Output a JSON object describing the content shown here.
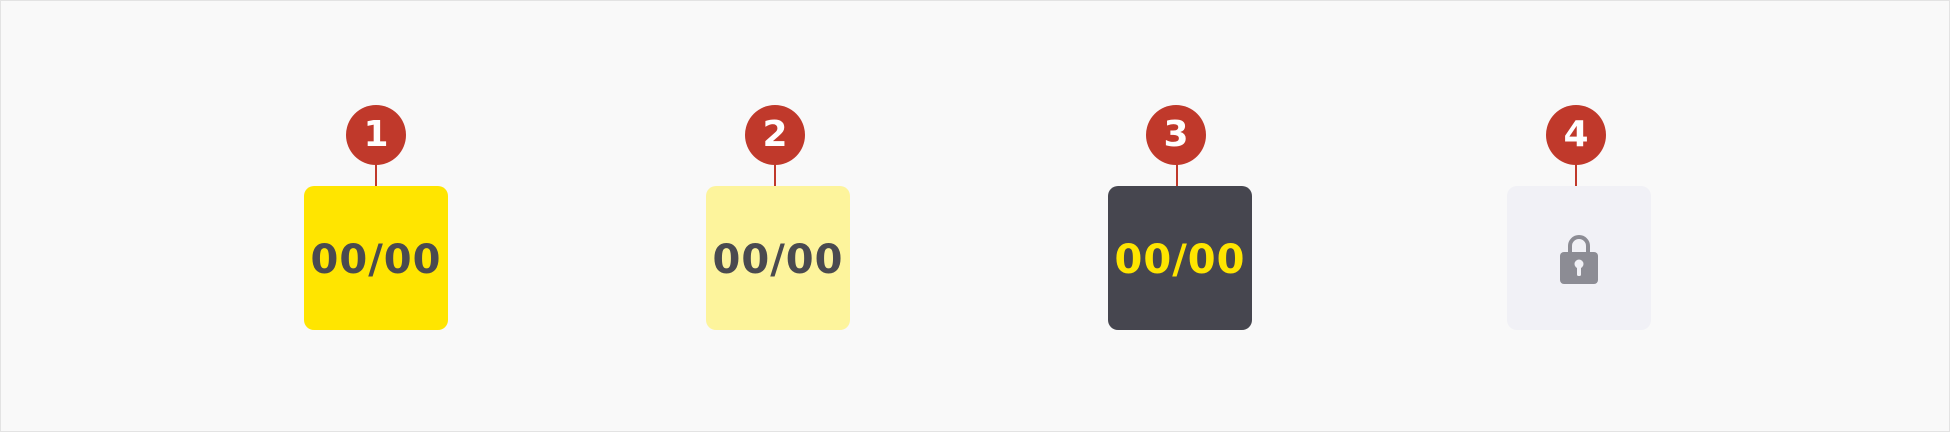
{
  "background_color": "#f9f9f9",
  "badge_color": "#c0392b",
  "items": [
    {
      "badge": "1",
      "text": "00/00",
      "state": "active",
      "card_color": "#ffe500",
      "text_color": "#4a4a4f"
    },
    {
      "badge": "2",
      "text": "00/00",
      "state": "default",
      "card_color": "#fdf49c",
      "text_color": "#4a4a4f"
    },
    {
      "badge": "3",
      "text": "00/00",
      "state": "selected",
      "card_color": "#46464f",
      "text_color": "#ffe500"
    },
    {
      "badge": "4",
      "state": "locked",
      "card_color": "#f1f1f6",
      "icon": "lock-icon",
      "icon_color": "#8c8c94"
    }
  ]
}
